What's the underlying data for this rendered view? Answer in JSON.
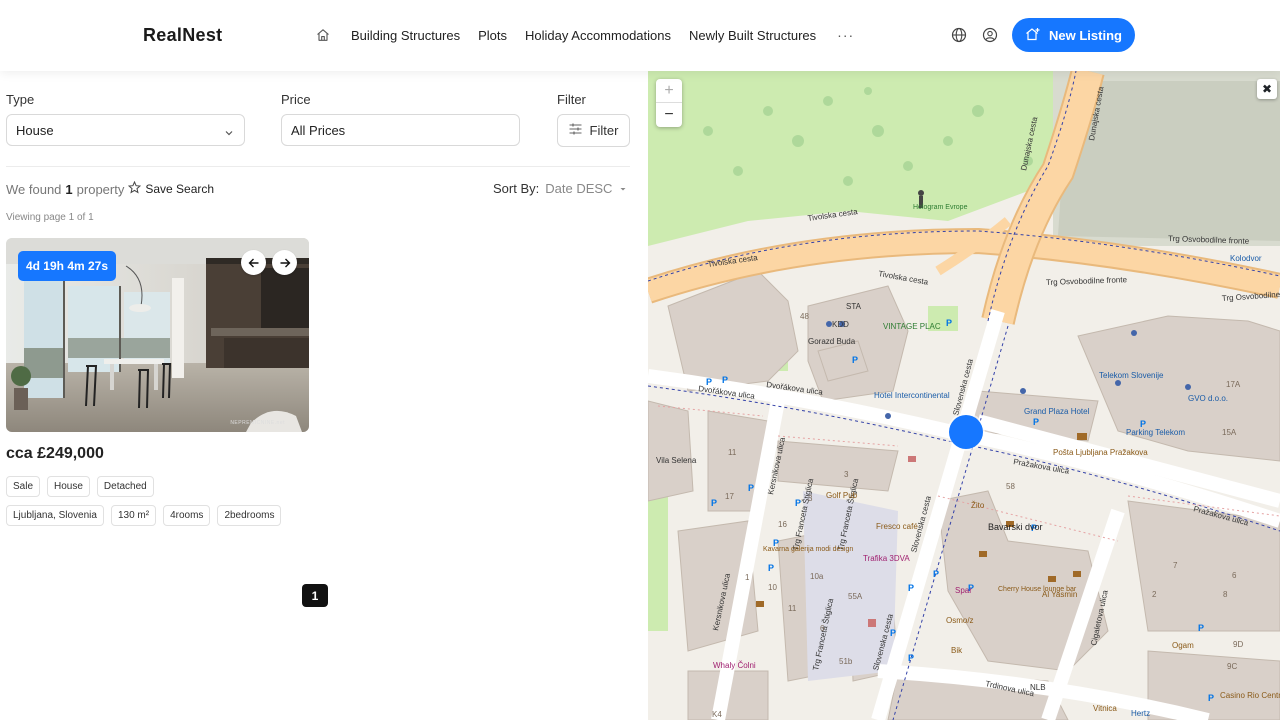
{
  "header": {
    "logo": "RealNest",
    "nav": [
      {
        "label": "Building Structures"
      },
      {
        "label": "Plots"
      },
      {
        "label": "Holiday Accommodations"
      },
      {
        "label": "Newly Built Structures"
      }
    ],
    "more": "···",
    "new_listing": "New Listing"
  },
  "filters": {
    "type_label": "Type",
    "type_value": "House",
    "price_label": "Price",
    "price_value": "All Prices",
    "filter_label": "Filter",
    "filter_button": "Filter"
  },
  "results": {
    "prefix": "We found",
    "count": "1",
    "suffix": "property",
    "save_search": "Save Search",
    "sort_label": "Sort By:",
    "sort_value": "Date DESC",
    "viewing": "Viewing page 1 of 1"
  },
  "listing": {
    "countdown": "4d 19h 4m 27s",
    "price": "cca £249,000",
    "tags1": [
      "Sale",
      "House",
      "Detached"
    ],
    "tags2": [
      "Ljubljana, Slovenia",
      "130 m²",
      "4rooms",
      "2bedrooms"
    ],
    "watermark": "NEPREMICNINE.net"
  },
  "pagination": {
    "current": "1"
  },
  "map": {
    "zoom_in": "+",
    "zoom_out": "−",
    "close": "✖",
    "labels": {
      "tivolska1": "Tivolska cesta",
      "tivolska2": "Tivolska cesta",
      "tivolska3": "Tivolska cesta",
      "trg1": "Trg Osvobodilne fronte",
      "trg2": "Trg Osvobodilne fronte",
      "trg3": "Trg Osvobodilne fronte",
      "dunajska1": "Dunajska cesta",
      "dunajska2": "Dunajska cesta",
      "hologram": "Hologram Evrope",
      "dvorakova1": "Dvořákova ulica",
      "dvorakova2": "Dvořákova ulica",
      "slovenska1": "Slovenska cesta",
      "slovenska2": "Slovenska cesta",
      "slovenska3": "Slovenska cesta",
      "hotel": "Hotel Intercontinental",
      "grand": "Grand Plaza Hotel",
      "telekom": "Telekom Slovenije",
      "parking": "Parking Telekom",
      "posta": "Pošta Ljubljana Pražakova",
      "prazakova1": "Pražakova ulica",
      "prazakova2": "Pražakova ulica",
      "bavarski": "Bavarski dvor",
      "kersnikova1": "Kersnikova ulica",
      "kersnikova2": "Kersnikova ulica",
      "francetova1": "Trg Franceta Štiglica",
      "francetova2": "Trg Franceta Štiglica",
      "francetova3": "Trg Franceta Štiglica",
      "villa": "Vila Selena",
      "golfpub": "Golf Pub",
      "fresco": "Fresco café",
      "kavarna": "Kavarna galerija modi design",
      "trafika": "Trafika 3DVA",
      "vintage": "VINTAGE PLAC",
      "gorazd": "Gorazd Buda",
      "kdd": "KDD",
      "sta": "STA",
      "gvo": "GVO d.o.o.",
      "zito": "Žito",
      "spar": "Spar",
      "osmoz": "Osmo/z",
      "bik": "Bik",
      "cherry": "Cherry House lounge bar",
      "alyasmin": "Al Yasmin",
      "cigaletova": "Cigaletova ulica",
      "trdinova": "Trdinova ulica",
      "whaly": "Whaly Čolni",
      "ogam": "Ogam",
      "nlb": "NLB",
      "vitnica": "Vitnica",
      "hertz": "Hertz",
      "kolodvor": "Kolodvor",
      "casino": "Casino Rio Central",
      "n48": "48",
      "n17a": "17A",
      "n15a": "15A",
      "n9c": "9C",
      "n9d": "9D",
      "n58": "58",
      "n55a": "55A",
      "n51b": "51b",
      "n10a": "10a",
      "n11": "11",
      "n10": "10",
      "n3": "3",
      "n6": "6",
      "n7": "7",
      "n2": "2",
      "n8": "8",
      "n16": "16",
      "n17": "17",
      "n1": "1",
      "n11b": "11",
      "n3b": "3",
      "n6b": "6",
      "k4": "K4"
    }
  }
}
